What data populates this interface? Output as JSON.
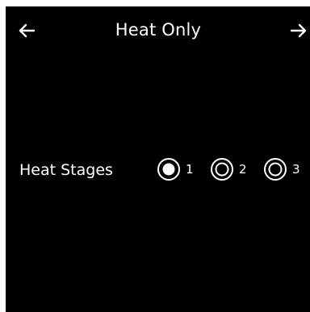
{
  "header": {
    "title": "Heat Only",
    "back_icon": "arrow-left-icon",
    "next_icon": "arrow-right-icon"
  },
  "heat_stages": {
    "label": "Heat Stages",
    "selected": "1",
    "options": [
      {
        "label": "1",
        "selected": true
      },
      {
        "label": "2",
        "selected": false
      },
      {
        "label": "3",
        "selected": false
      }
    ]
  },
  "colors": {
    "background": "#000000",
    "foreground": "#ffffff"
  }
}
